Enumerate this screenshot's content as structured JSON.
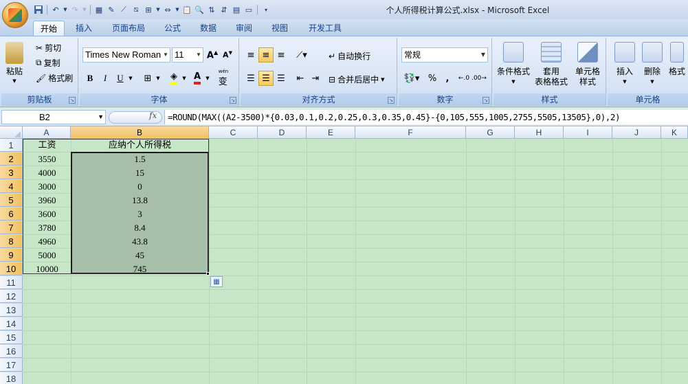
{
  "window": {
    "title": "个人所得税计算公式.xlsx - Microsoft Excel"
  },
  "tabs": [
    "开始",
    "插入",
    "页面布局",
    "公式",
    "数据",
    "审阅",
    "视图",
    "开发工具"
  ],
  "ribbon": {
    "clipboard": {
      "label": "剪贴板",
      "paste": "粘贴",
      "cut": "剪切",
      "copy": "复制",
      "format_painter": "格式刷"
    },
    "font": {
      "label": "字体",
      "font_name": "Times New Roman",
      "font_size": "11",
      "bold": "B",
      "italic": "I",
      "underline": "U",
      "wen": "wén"
    },
    "alignment": {
      "label": "对齐方式",
      "wrap": "自动换行",
      "merge": "合并后居中"
    },
    "number": {
      "label": "数字",
      "format": "常规",
      "percent": "%",
      "comma": ","
    },
    "styles": {
      "label": "样式",
      "conditional": "条件格式",
      "table_line1": "套用",
      "table_line2": "表格格式",
      "cell_style_line1": "单元格",
      "cell_style_line2": "样式"
    },
    "cells": {
      "label": "单元格",
      "insert": "插入",
      "delete": "删除",
      "format": "格式"
    }
  },
  "formula_bar": {
    "name_box": "B2",
    "fx": "fx",
    "formula": "=ROUND(MAX((A2-3500)*{0.03,0.1,0.2,0.25,0.3,0.35,0.45}-{0,105,555,1005,2755,5505,13505},0),2)"
  },
  "sheet": {
    "columns": [
      "A",
      "B",
      "C",
      "D",
      "E",
      "F",
      "G",
      "H",
      "I",
      "J",
      "K"
    ],
    "row_numbers": [
      "1",
      "2",
      "3",
      "4",
      "5",
      "6",
      "7",
      "8",
      "9",
      "10",
      "11",
      "12",
      "13",
      "14",
      "15",
      "16",
      "17",
      "18"
    ],
    "header_row": {
      "a": "工资",
      "b": "应纳个人所得税"
    },
    "rows": [
      {
        "a": "3550",
        "b": "1.5"
      },
      {
        "a": "4000",
        "b": "15"
      },
      {
        "a": "3000",
        "b": "0"
      },
      {
        "a": "3960",
        "b": "13.8"
      },
      {
        "a": "3600",
        "b": "3"
      },
      {
        "a": "3780",
        "b": "8.4"
      },
      {
        "a": "4960",
        "b": "43.8"
      },
      {
        "a": "5000",
        "b": "45"
      },
      {
        "a": "10000",
        "b": "745"
      }
    ]
  },
  "colors": {
    "sheet_background": "#c7e6c8",
    "selection_fill": "#a8bfa9",
    "header_highlight": "#f1c15f"
  }
}
